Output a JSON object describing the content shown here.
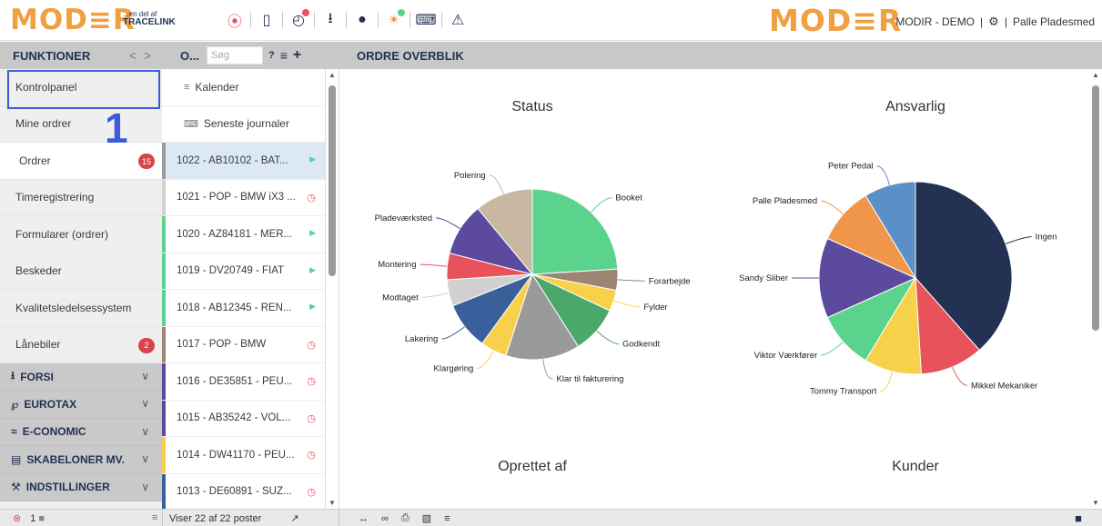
{
  "topbar": {
    "logo": "MOD≡R",
    "logo_sub_top": "...en del af",
    "logo_sub_bottom": "TRACELINK",
    "logo_right": "MOD≡R",
    "user_area": "MODIR - DEMO",
    "user_name": "Palle Pladesmed",
    "separator": "|"
  },
  "header": {
    "functions_label": "FUNKTIONER",
    "orders_label": "O...",
    "search_placeholder": "Søg",
    "help": "?",
    "overview_title": "ORDRE OVERBLIK"
  },
  "functions": {
    "items": [
      {
        "label": "Kontrolpanel"
      },
      {
        "label": "Mine ordrer"
      },
      {
        "label": "Ordrer",
        "badge": "15"
      },
      {
        "label": "Timeregistrering"
      },
      {
        "label": "Formularer (ordrer)"
      },
      {
        "label": "Beskeder"
      },
      {
        "label": "Kvalitetsledelsessystem"
      },
      {
        "label": "Lånebiler",
        "badge": "2"
      }
    ],
    "sections": [
      {
        "label": "FORSI",
        "icon": "⭳"
      },
      {
        "label": "EUROTAX",
        "icon": "℘"
      },
      {
        "label": "E-CONOMIC",
        "icon": "≈"
      },
      {
        "label": "SKABELONER MV.",
        "icon": "▤"
      },
      {
        "label": "INDSTILLINGER",
        "icon": "⚒"
      }
    ],
    "annotation": "1"
  },
  "orders": {
    "links": [
      {
        "label": "Kalender"
      },
      {
        "label": "Seneste journaler"
      }
    ],
    "rows": [
      {
        "label": "1022 - AB10102 - BAT...",
        "status": "play",
        "strip": "#9a9a9a",
        "selected": true
      },
      {
        "label": "1021 - POP - BMW iX3 ...",
        "status": "clock",
        "strip": "#d0d0d0"
      },
      {
        "label": "1020 - AZ84181 - MER...",
        "status": "play",
        "strip": "#5bd38c"
      },
      {
        "label": "1019 - DV20749 - FIAT",
        "status": "play",
        "strip": "#5bd38c"
      },
      {
        "label": "1018 - AB12345 - REN...",
        "status": "play",
        "strip": "#5bd38c"
      },
      {
        "label": "1017 - POP - BMW",
        "status": "clock",
        "strip": "#9d8473"
      },
      {
        "label": "1016 - DE35851 - PEU...",
        "status": "clock",
        "strip": "#5b4a9e"
      },
      {
        "label": "1015 - AB35242 - VOL...",
        "status": "clock",
        "strip": "#5b4a9e"
      },
      {
        "label": "1014 - DW41170 - PEU...",
        "status": "clock",
        "strip": "#f7d14a"
      },
      {
        "label": "1013 - DE60891 - SUZ...",
        "status": "clock",
        "strip": "#3a5f9a"
      }
    ],
    "count_text": "Viser 22 af 22 poster"
  },
  "bottom": {
    "badge_left": "1"
  },
  "chart_data": [
    {
      "type": "pie",
      "title": "Status",
      "slices": [
        {
          "label": "Booket",
          "value": 24,
          "color": "#5bd38c"
        },
        {
          "label": "Forarbejde",
          "value": 4,
          "color": "#9d8473"
        },
        {
          "label": "Fylder",
          "value": 4,
          "color": "#f7d14a"
        },
        {
          "label": "Godkendt",
          "value": 9,
          "color": "#4aa86a"
        },
        {
          "label": "Klar til fakturering",
          "value": 14,
          "color": "#9a9a9a"
        },
        {
          "label": "Klargøring",
          "value": 5,
          "color": "#f7d14a"
        },
        {
          "label": "Lakering",
          "value": 9,
          "color": "#3a5f9a"
        },
        {
          "label": "Modtaget",
          "value": 5,
          "color": "#d0d0d0"
        },
        {
          "label": "Montering",
          "value": 5,
          "color": "#e8525a"
        },
        {
          "label": "Pladeværksted",
          "value": 10,
          "color": "#5b4a9e"
        },
        {
          "label": "Polering",
          "value": 11,
          "color": "#c8b8a2"
        }
      ]
    },
    {
      "type": "pie",
      "title": "Ansvarlig",
      "slices": [
        {
          "label": "Ingen",
          "value": 40,
          "color": "#233153"
        },
        {
          "label": "Mikkel Mekaniker",
          "value": 11,
          "color": "#e8525a"
        },
        {
          "label": "Tommy Transport",
          "value": 10,
          "color": "#f7d14a"
        },
        {
          "label": "Viktor Værkfører",
          "value": 10,
          "color": "#5bd38c"
        },
        {
          "label": "Sandy Sliber",
          "value": 14,
          "color": "#5b4a9e"
        },
        {
          "label": "Palle Pladesmed",
          "value": 10,
          "color": "#f0964a"
        },
        {
          "label": "Peter Pedal",
          "value": 9,
          "color": "#5a8fc8"
        }
      ]
    },
    {
      "type": "pie",
      "title": "Oprettet af",
      "slices": []
    },
    {
      "type": "pie",
      "title": "Kunder",
      "slices": []
    }
  ]
}
